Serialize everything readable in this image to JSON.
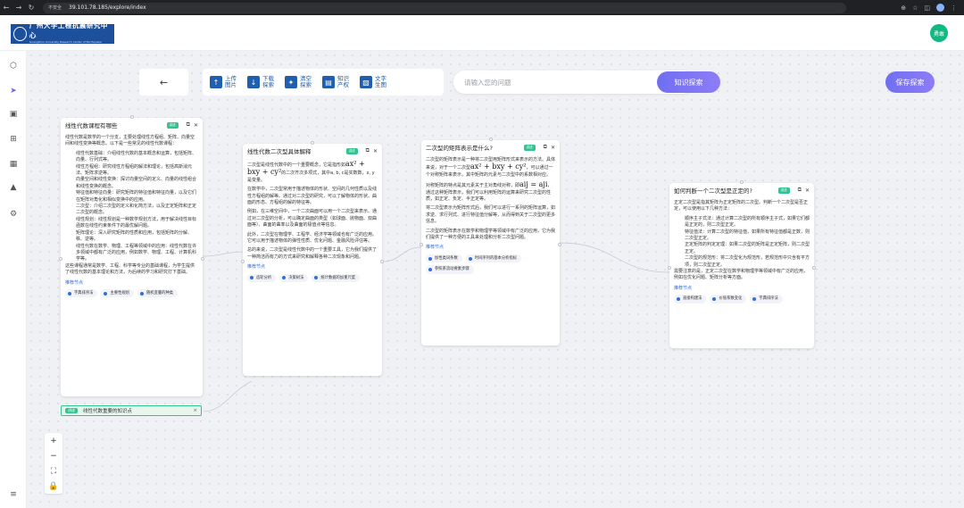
{
  "browser": {
    "security": "不安全",
    "url": "39.101.78.185/explore/index"
  },
  "header": {
    "logo_name": "广州大学工程抗震研究中心",
    "logo_sub": "Guangzhou University Research Center of Earthquake Engineering",
    "user": "勇敢"
  },
  "sidebar": {
    "icons": [
      "cube-icon",
      "share-icon",
      "image-icon",
      "grid-icon",
      "calendar-icon",
      "graduation-cap-icon",
      "settings-icon",
      "menu-icon"
    ]
  },
  "toolbar": {
    "back": "←",
    "tools": [
      {
        "icon": "↑",
        "label": "上传图片"
      },
      {
        "icon": "↓",
        "label": "下载探索"
      },
      {
        "icon": "✦",
        "label": "清空探索"
      },
      {
        "icon": "▤",
        "label": "知识产权"
      },
      {
        "icon": "▧",
        "label": "文字生图"
      }
    ],
    "search_placeholder": "请输入您的问题",
    "search_button": "知识探索",
    "save_button": "保存探索"
  },
  "cards": [
    {
      "title": "线性代数课程有哪些",
      "badge": "讲述",
      "blocks": [
        {
          "type": "p",
          "text": "线性代数是数学的一个分支，主要处理线性方程组、矩阵、向量空间和线性变换等概念。以下是一些常见的线性代数课程："
        },
        {
          "type": "ind",
          "text": "线性代数基础：介绍线性代数的基本概念和运算，包括矩阵、向量、行列式等。"
        },
        {
          "type": "ind",
          "text": "线性方程组：研究线性方程组的解法和理论，包括高斯消元法、矩阵求逆等。"
        },
        {
          "type": "ind",
          "text": "向量空间和线性变换：探讨向量空间的定义、向量的线性组合和线性变换的概念。"
        },
        {
          "type": "ind",
          "text": "特征值和特征向量：研究矩阵的特征值和特征向量，以及它们在矩阵对角化和相似变换中的应用。"
        },
        {
          "type": "ind",
          "text": "二次型：介绍二次型的定义和化简方法，以及正定矩阵和正定二次型的概念。"
        },
        {
          "type": "ind",
          "text": "线性规划：线性规划是一种数学规划方法，用于解决线性目标函数在线性约束条件下的最优解问题。"
        },
        {
          "type": "ind",
          "text": "矩阵理论：深入研究矩阵的性质和应用，包括矩阵的分解、秩、逆等。"
        },
        {
          "type": "ind",
          "text": "线性代数在数学、物理、工程等领域中的应用：线性代数在许多领域中都有广泛的应用，例如数学、物理、工程、计算机科学等。"
        },
        {
          "type": "p",
          "text": "这些课程通常是数学、工程、科学等专业的基础课程，为学生提供了线性代数的基本理论和方法，为后续的学习和研究打下基础。"
        }
      ],
      "rec_label": "推荐节点",
      "chips": [
        "字典排序法",
        "主要性规划",
        "随机变量的种类"
      ]
    },
    {
      "title": "线性代数二次型具体解释",
      "badge": "讲述",
      "blocks": [
        {
          "type": "p",
          "text": "二次型是线性代数中的一个重要概念，它是指形如"
        },
        {
          "type": "big",
          "text": "ax² + bxy + cy²"
        },
        {
          "type": "p",
          "text": "的二次齐次多项式，其中a, b, c是实数数，x, y是变量。"
        },
        {
          "type": "p",
          "text": "在数学中，二次型常用于描述物体的形状、空间的几何性质以及线性方程组的解等。通过对二次型的研究，可以了解物体的形状、曲面的形态、方程组的解的特征等。"
        },
        {
          "type": "p",
          "text": "例如，在三维空间中，一个二次曲面可以用一个二次型来表示。通过对二次型的分析，可以确定曲面的类型（如球面、抛物面、双曲面等）、曲面的曲率以及曲面的极值点等信息。"
        },
        {
          "type": "p",
          "text": "此外，二次型在物理学、工程学、经济学等领域也有广泛的应用。它可以用于描述物体的弹性性质、优化问题、金融风险评估等。"
        },
        {
          "type": "p",
          "text": "总的来说，二次型是线性代数中的一个重要工具，它为我们提供了一种简洁而有力的方式来研究和解释各种二次现象和问题。"
        }
      ],
      "rec_label": "推荐节点",
      "chips": [
        "齿轮分析",
        "决策树法",
        "统计数据的加重尺度"
      ]
    },
    {
      "title": "二次型的矩阵表示是什么?",
      "badge": "讲述",
      "blocks": [
        {
          "type": "p",
          "text": "二次型的矩阵表示是一种将二次型用矩阵形式来表示的方法。具体来说，对于一个二次型"
        },
        {
          "type": "big",
          "text": "ax² + bxy + cy²"
        },
        {
          "type": "p",
          "text": "，可以通过一个对称矩阵来表示，其中矩阵的元素与二次型中的系数相对应。"
        },
        {
          "type": "p",
          "text": "对称矩阵的特点是其元素关于主对角线对称，即"
        },
        {
          "type": "big",
          "text": "aij = aji"
        },
        {
          "type": "p",
          "text": "，通过这种矩阵表示，我们可以利用矩阵的运算来研究二次型的性质，如正定、负定、半正定等。"
        },
        {
          "type": "p",
          "text": "将二次型表示为矩阵形式后，我们可以进行一系列的矩阵运算，如求逆、求行列式、进行特征值分解等，从而得到关于二次型的更多信息。"
        },
        {
          "type": "p",
          "text": "二次型的矩阵表示在数学和物理学等领域中有广泛的应用，它为我们提供了一种方便的工具来处理和分析二次型问题。"
        }
      ],
      "rec_label": "推荐节点",
      "chips": [
        "加性类词条数",
        "时间序列的基本分析指标",
        "参照系流动要素步骤"
      ]
    },
    {
      "title": "如何判断一个二次型是正定的?",
      "badge": "讲述",
      "blocks": [
        {
          "type": "p",
          "text": "正定二次型是指其矩阵为正定矩阵的二次型。判断一个二次型是否正定，可以使用以下几种方法："
        },
        {
          "type": "ind",
          "text": "顺序主子式法：通过计算二次型的所有顺序主子式，如果它们都是正定的，则二次型正定。"
        },
        {
          "type": "ind",
          "text": "特征值法：计算二次型的特征值，如果所有特征值都是正数，则二次型正定。"
        },
        {
          "type": "ind",
          "text": "正定矩阵的判定定理：如果二次型的矩阵是正定矩阵，则二次型正定。"
        },
        {
          "type": "ind",
          "text": "二次型的规范形：将二次型化为规范形，若规范形中只含有平方项，则二次型正定。"
        },
        {
          "type": "p",
          "text": "需要注意的是，正定二次型在数学和物理学等领域中有广泛的应用，例如在优化问题、矩阵分析等方面。"
        }
      ],
      "rec_label": "推荐节点",
      "chips": [
        "直接构建法",
        "价值系数变化",
        "字典排序法"
      ]
    }
  ],
  "pending_node": {
    "tag": "讲述",
    "title": "线性代数重要的知识点",
    "close": "×"
  },
  "zoom": {
    "zoom_in": "+",
    "zoom_out": "−",
    "fit": "⛶",
    "lock": "🔒"
  }
}
